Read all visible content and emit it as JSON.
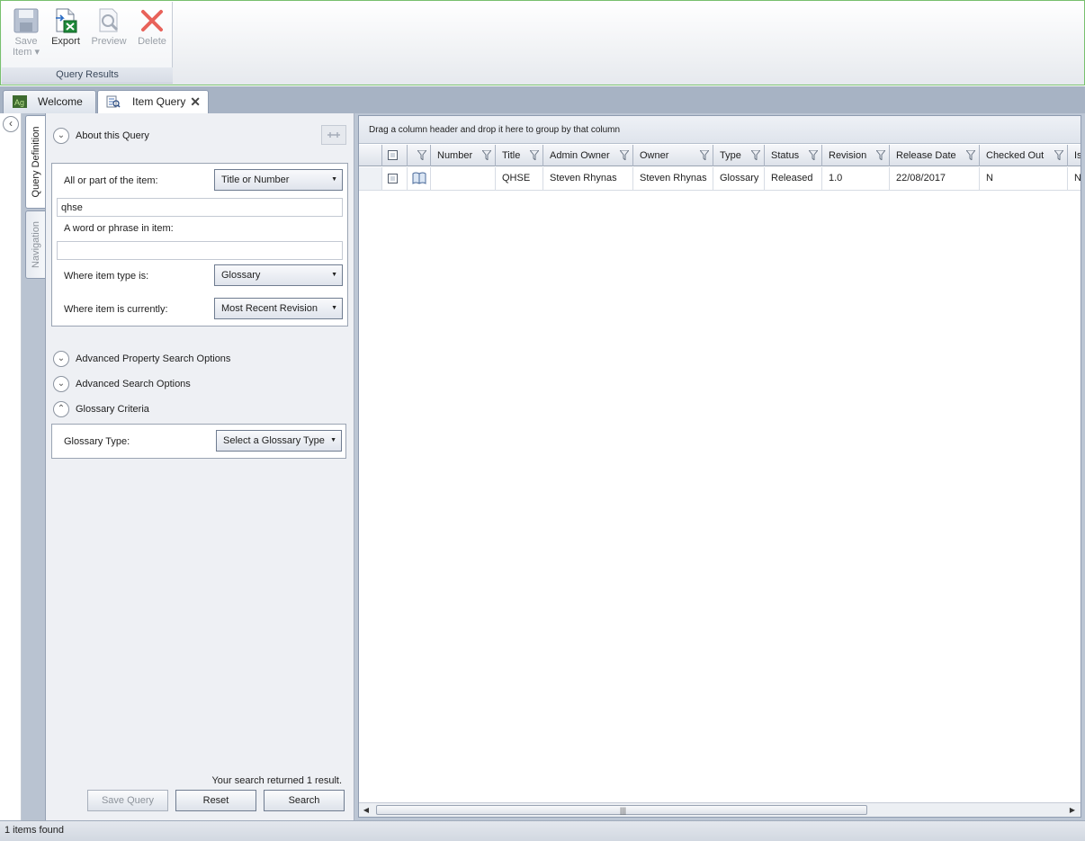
{
  "ribbon": {
    "save_label": "Save",
    "save_sub": "Item ▾",
    "export_label": "Export",
    "preview_label": "Preview",
    "delete_label": "Delete",
    "group_label": "Query Results"
  },
  "tabs": [
    {
      "label": "Welcome",
      "active": false,
      "icon": "ag-logo-icon"
    },
    {
      "label": "Item Query",
      "active": true,
      "icon": "item-query-icon",
      "close": "✕"
    }
  ],
  "side_tabs": [
    {
      "label": "Query Definition",
      "active": true
    },
    {
      "label": "Navigation",
      "active": false
    }
  ],
  "query": {
    "about_label": "About this Query",
    "item_label": "All or part of the item:",
    "item_field_combo": "Title or Number",
    "item_value": "qhse",
    "phrase_label": "A word or phrase in item:",
    "phrase_value": "",
    "type_label": "Where item type is:",
    "type_combo": "Glossary",
    "current_label": "Where item is currently:",
    "current_combo": "Most Recent Revision",
    "advanced_property_label": "Advanced Property Search Options",
    "advanced_search_label": "Advanced Search Options",
    "glossary_criteria_label": "Glossary Criteria",
    "glossary_type_label": "Glossary Type:",
    "glossary_type_combo": "Select a Glossary Type",
    "result_text": "Your search returned 1 result.",
    "save_query_label": "Save Query",
    "reset_label": "Reset",
    "search_label": "Search"
  },
  "grid": {
    "group_hint": "Drag a column header and drop it here to group by that column",
    "columns": [
      "Number",
      "Title",
      "Admin Owner",
      "Owner",
      "Type",
      "Status",
      "Revision",
      "Release Date",
      "Checked Out",
      "Is"
    ],
    "rows": [
      {
        "number": "",
        "title": "QHSE",
        "admin_owner": "Steven Rhynas",
        "owner": "Steven Rhynas",
        "type": "Glossary",
        "status": "Released",
        "revision": "1.0",
        "release_date": "22/08/2017",
        "checked_out": "N",
        "is": "N"
      }
    ],
    "scroll_grip": "|||"
  },
  "status": {
    "text": "1 items found"
  },
  "colors": {
    "ribbon_border": "#78c06e",
    "tabs_bar": "#a7b3c4",
    "grid_frame": "#bcc6d4"
  }
}
